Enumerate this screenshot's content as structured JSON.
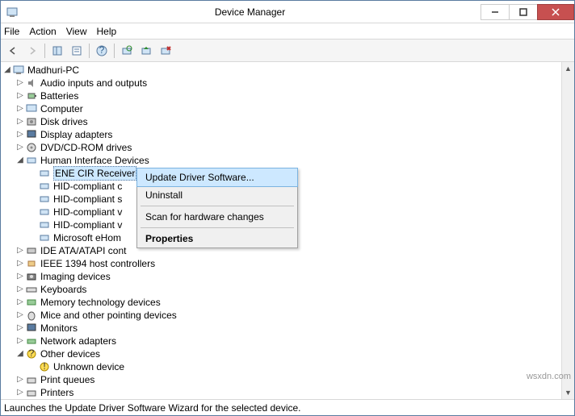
{
  "window": {
    "title": "Device Manager"
  },
  "menu": {
    "file": "File",
    "action": "Action",
    "view": "View",
    "help": "Help"
  },
  "tree": {
    "root": "Madhuri-PC",
    "items": [
      {
        "label": "Audio inputs and outputs",
        "expanded": false
      },
      {
        "label": "Batteries",
        "expanded": false
      },
      {
        "label": "Computer",
        "expanded": false
      },
      {
        "label": "Disk drives",
        "expanded": false
      },
      {
        "label": "Display adapters",
        "expanded": false
      },
      {
        "label": "DVD/CD-ROM drives",
        "expanded": false
      },
      {
        "label": "Human Interface Devices",
        "expanded": true,
        "children": [
          "ENE CIR Receiver",
          "HID-compliant c",
          "HID-compliant s",
          "HID-compliant v",
          "HID-compliant v",
          "Microsoft eHom"
        ]
      },
      {
        "label": "IDE ATA/ATAPI cont",
        "expanded": false,
        "truncated": true
      },
      {
        "label": "IEEE 1394 host controllers",
        "expanded": false
      },
      {
        "label": "Imaging devices",
        "expanded": false
      },
      {
        "label": "Keyboards",
        "expanded": false
      },
      {
        "label": "Memory technology devices",
        "expanded": false
      },
      {
        "label": "Mice and other pointing devices",
        "expanded": false
      },
      {
        "label": "Monitors",
        "expanded": false
      },
      {
        "label": "Network adapters",
        "expanded": false
      },
      {
        "label": "Other devices",
        "expanded": true,
        "children": [
          "Unknown device"
        ]
      },
      {
        "label": "Print queues",
        "expanded": false
      },
      {
        "label": "Printers",
        "expanded": false
      }
    ]
  },
  "context": {
    "update": "Update Driver Software...",
    "uninstall": "Uninstall",
    "scan": "Scan for hardware changes",
    "properties": "Properties"
  },
  "status": "Launches the Update Driver Software Wizard for the selected device.",
  "watermark": "wsxdn.com"
}
